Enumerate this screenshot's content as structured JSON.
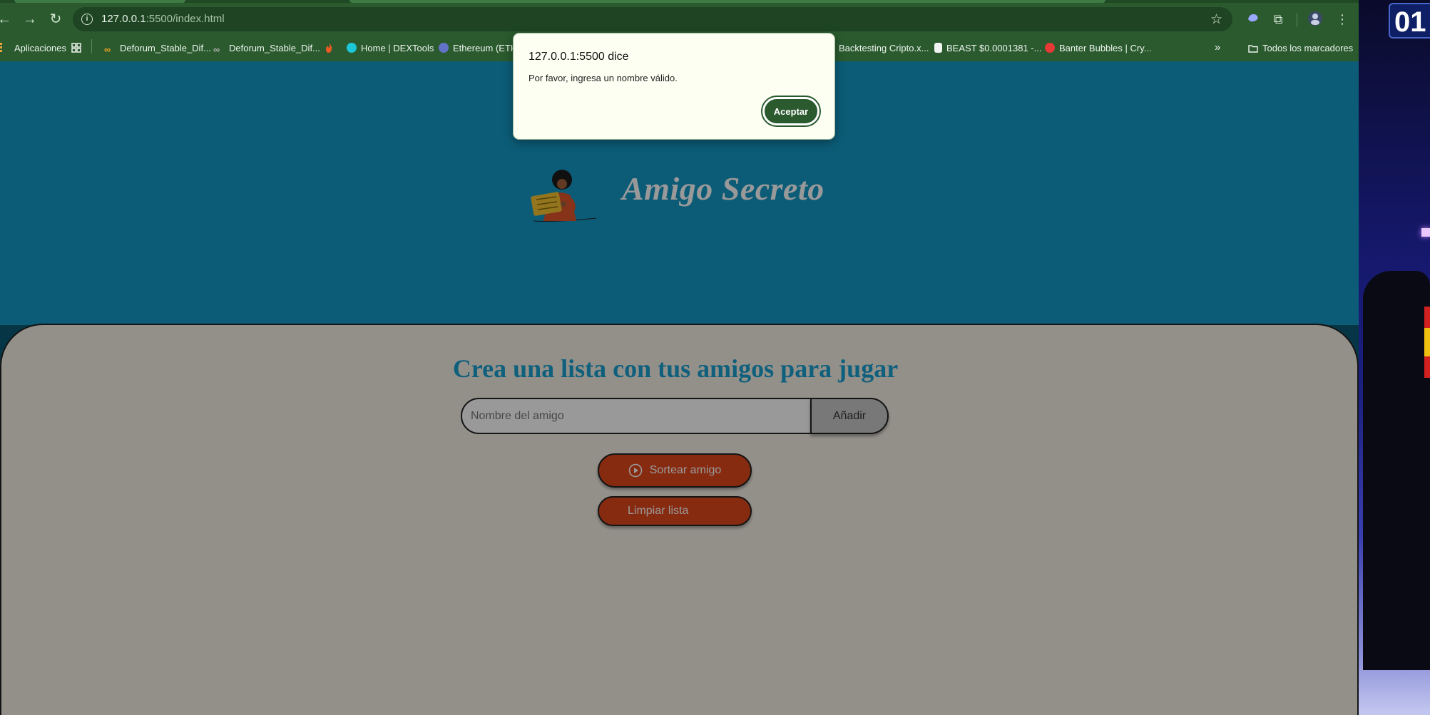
{
  "browser": {
    "url_host": "127.0.0.1",
    "url_path": ":5500/index.html",
    "bookmarks": [
      {
        "label": "Aplicaciones",
        "color": "#e8a33c"
      },
      {
        "label": "Deforum_Stable_Dif...",
        "color": "#f0a020"
      },
      {
        "label": "Deforum_Stable_Dif...",
        "color": "#b0b0b0"
      },
      {
        "label": "Home | DEXTools",
        "color": "#1cc8d8"
      },
      {
        "label": "Ethereum (ETH)",
        "color": "#6272c8"
      },
      {
        "label": "Backtesting Cripto.x...",
        "color": "#3a6a3a"
      },
      {
        "label": "BEAST $0.0001381 -...",
        "color": "#f2f2f2"
      },
      {
        "label": "Banter Bubbles | Cry...",
        "color": "#e53935"
      }
    ],
    "all_bookmarks_label": "Todos los marcadores"
  },
  "page": {
    "title": "Amigo Secreto",
    "subtitle": "Crea una lista con tus amigos para jugar",
    "input_placeholder": "Nombre del amigo",
    "add_label": "Añadir",
    "draw_label": "Sortear amigo",
    "clear_label": "Limpiar lista"
  },
  "dialog": {
    "title": "127.0.0.1:5500 dice",
    "message": "Por favor, ingresa un nombre válido.",
    "ok_label": "Aceptar"
  },
  "side_video": {
    "badge": "01"
  },
  "colors": {
    "chrome_green": "#2a5a2e",
    "hero_blue": "#1599c7",
    "card_bg": "#f6f0e6",
    "accent_orange": "#e1481c",
    "subtitle_blue": "#1aa0d0"
  }
}
